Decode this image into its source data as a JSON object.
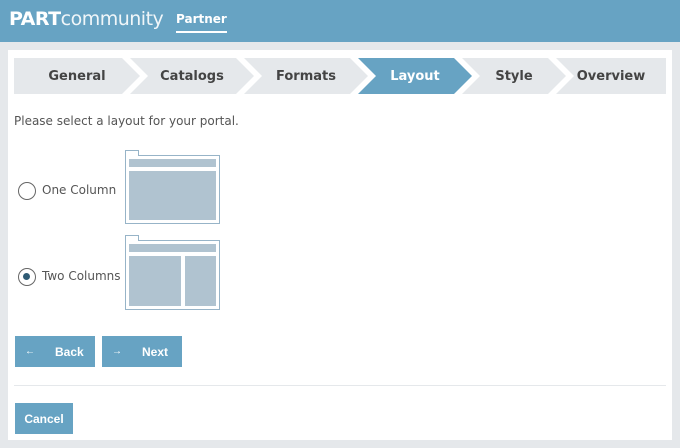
{
  "header": {
    "logo_bold": "PART",
    "logo_light": "community",
    "nav_active": "Partner"
  },
  "steps": [
    {
      "label": "General",
      "active": false
    },
    {
      "label": "Catalogs",
      "active": false
    },
    {
      "label": "Formats",
      "active": false
    },
    {
      "label": "Layout",
      "active": true
    },
    {
      "label": "Style",
      "active": false
    },
    {
      "label": "Overview",
      "active": false
    }
  ],
  "prompt": "Please select a layout for your portal.",
  "options": [
    {
      "label": "One Column",
      "selected": false
    },
    {
      "label": "Two Columns",
      "selected": true
    }
  ],
  "buttons": {
    "back": "Back",
    "back_icon": "←",
    "next": "Next",
    "next_icon": "→",
    "cancel": "Cancel"
  },
  "colors": {
    "accent": "#67a3c3",
    "background": "#e5e8eb"
  }
}
